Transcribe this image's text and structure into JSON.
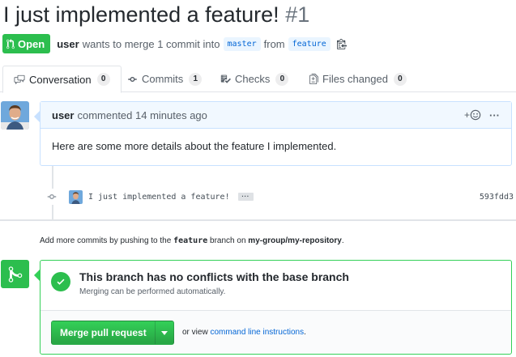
{
  "pr": {
    "title": "I just implemented a feature!",
    "number": "#1",
    "state": "Open",
    "author": "user",
    "merge_text": "wants to merge 1 commit into",
    "base_branch": "master",
    "from_text": "from",
    "head_branch": "feature"
  },
  "tabs": [
    {
      "label": "Conversation",
      "count": "0",
      "icon": "comment-discussion-icon"
    },
    {
      "label": "Commits",
      "count": "1",
      "icon": "git-commit-icon"
    },
    {
      "label": "Checks",
      "count": "0",
      "icon": "checklist-icon"
    },
    {
      "label": "Files changed",
      "count": "0",
      "icon": "file-diff-icon"
    }
  ],
  "comment": {
    "author": "user",
    "time_text": "commented 14 minutes ago",
    "reaction_icon": "smiley-plus-icon",
    "menu": "···",
    "body": "Here are some more details about the feature I implemented."
  },
  "commit": {
    "message": "I just implemented a feature!",
    "ellipsis": "···",
    "sha": "593fdd3"
  },
  "push_hint": {
    "prefix": "Add more commits by pushing to the",
    "branch": "feature",
    "middle": "branch on",
    "repo": "my-group/my-repository",
    "suffix": "."
  },
  "merge": {
    "heading": "This branch has no conflicts with the base branch",
    "subtext": "Merging can be performed automatically.",
    "button_label": "Merge pull request",
    "alt_prefix": "or view",
    "alt_link": "command line instructions",
    "alt_suffix": "."
  },
  "colors": {
    "open_green": "#2cbe4e",
    "link_blue": "#0366d6",
    "comment_border": "#c8e1ff"
  }
}
